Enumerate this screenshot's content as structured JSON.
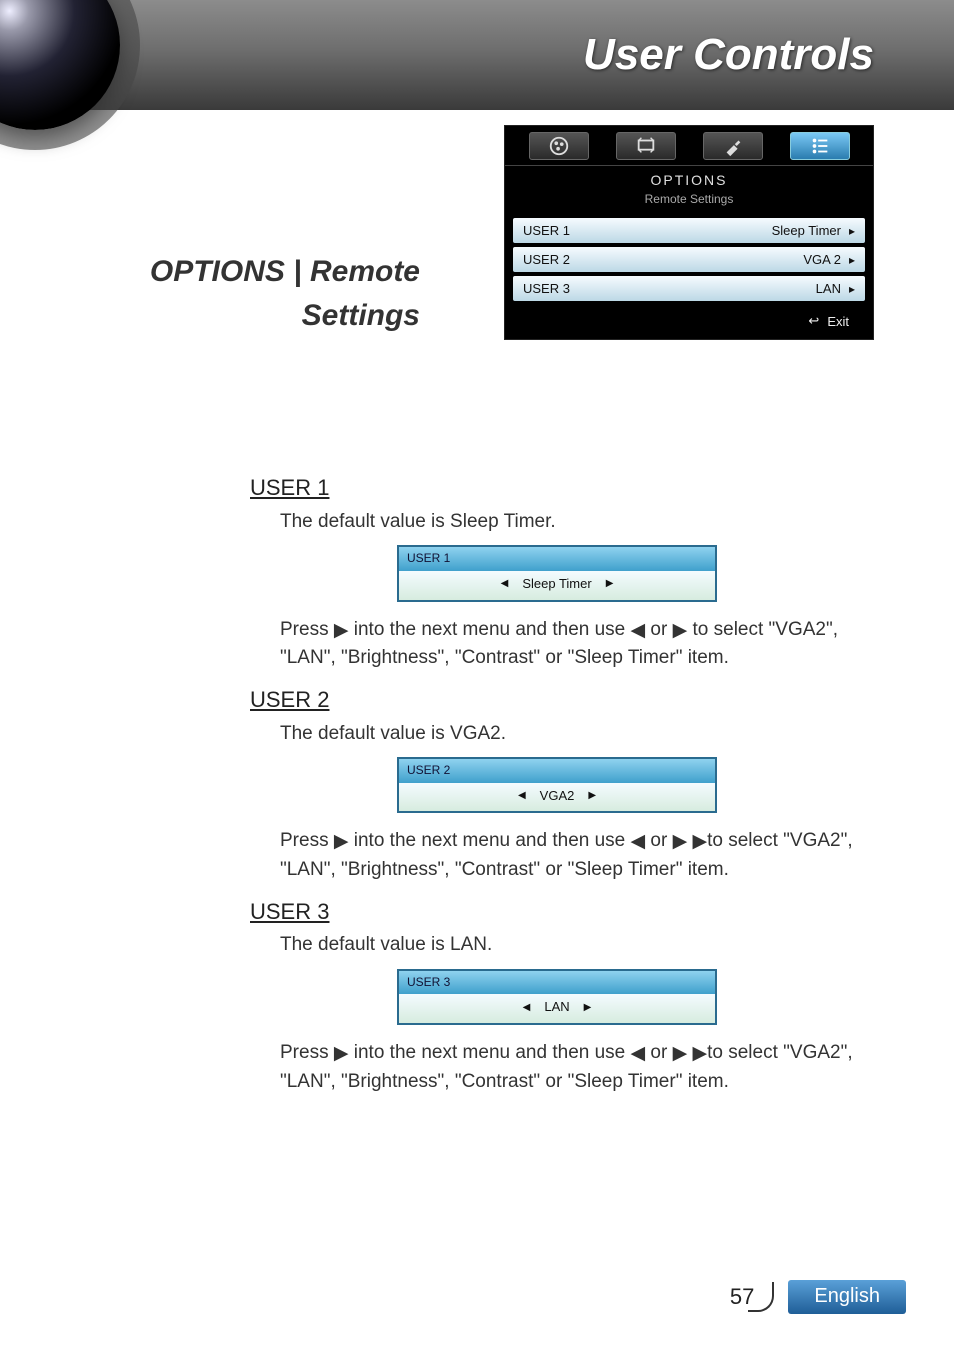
{
  "header": {
    "title": "User Controls"
  },
  "section": {
    "title": "OPTIONS | Remote Settings"
  },
  "osd": {
    "title": "OPTIONS",
    "subtitle": "Remote Settings",
    "rows": [
      {
        "label": "USER 1",
        "value": "Sleep Timer"
      },
      {
        "label": "USER 2",
        "value": "VGA 2"
      },
      {
        "label": "USER 3",
        "value": "LAN"
      }
    ],
    "exit": "Exit"
  },
  "content": {
    "user1": {
      "heading": "USER 1",
      "default_line": "The default value is Sleep Timer.",
      "selector_label": "USER 1",
      "selector_value": "Sleep Timer",
      "press_a": "Press ",
      "press_b": " into the next menu and then use ",
      "press_c": " or ",
      "press_d": " to select \"VGA2\", \"LAN\", \"Brightness\", \"Contrast\" or \"Sleep Timer\" item."
    },
    "user2": {
      "heading": "USER 2",
      "default_line": "The default value is VGA2.",
      "selector_label": "USER 2",
      "selector_value": "VGA2",
      "press_a": "Press ",
      "press_b": " into the next menu and then use ",
      "press_c": " or ",
      "press_d": "to select \"VGA2\", \"LAN\", \"Brightness\", \"Contrast\" or \"Sleep Timer\" item."
    },
    "user3": {
      "heading": "USER 3",
      "default_line": "The default value is LAN.",
      "selector_label": "USER 3",
      "selector_value": "LAN",
      "press_a": "Press ",
      "press_b": " into the next menu and then use ",
      "press_c": " or ",
      "press_d": "to select \"VGA2\", \"LAN\", \"Brightness\", \"Contrast\" or \"Sleep Timer\" item."
    }
  },
  "footer": {
    "page": "57",
    "language": "English"
  }
}
